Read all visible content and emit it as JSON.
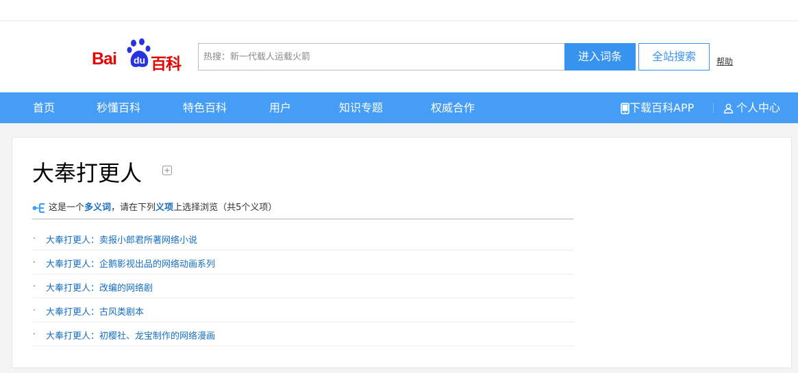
{
  "logo": {
    "brand_en": "Bai",
    "paw_text": "du",
    "brand_cn": "百科"
  },
  "search": {
    "placeholder": "热搜：新一代载人运载火箭",
    "enter_button": "进入词条",
    "site_button": "全站搜索",
    "help_link": "帮助"
  },
  "nav": {
    "items": [
      "首页",
      "秒懂百科",
      "特色百科",
      "用户",
      "知识专题",
      "权威合作"
    ],
    "download_app": "下载百科APP",
    "user_center": "个人中心"
  },
  "entry": {
    "title": "大奉打更人",
    "polysemy": {
      "prefix": "这是一个",
      "term": "多义词",
      "middle": "，请在下列",
      "sense": "义项",
      "suffix": "上选择浏览（共5个义项）"
    },
    "senses": [
      "大奉打更人：卖报小郎君所著网络小说",
      "大奉打更人：企鹅影视出品的网络动画系列",
      "大奉打更人：改编的网络剧",
      "大奉打更人：古风类剧本",
      "大奉打更人：初樱社、龙宝制作的网络漫画"
    ]
  },
  "colors": {
    "brand_red": "#e10601",
    "nav_blue": "#459df5",
    "button_blue": "#3893ee",
    "link_blue": "#136ec2"
  },
  "icons": [
    "paw-icon",
    "phone-icon",
    "user-icon",
    "add-icon",
    "polysemy-icon"
  ]
}
